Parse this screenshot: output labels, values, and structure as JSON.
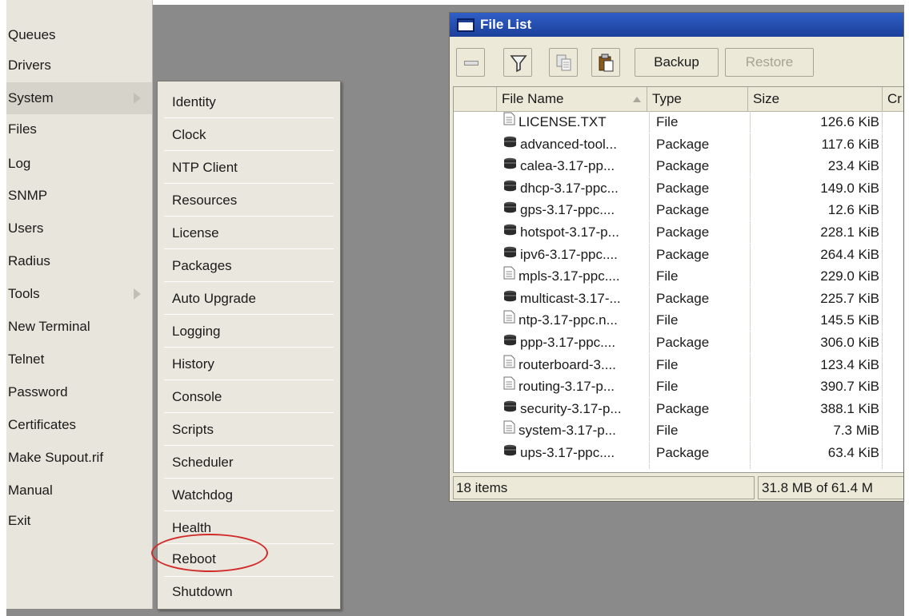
{
  "colors": {
    "desktop": "#8a8a8a",
    "menu_bg": "#e8e5dc",
    "title_bar": "#2f5fc7",
    "annotation": "#d12a2a"
  },
  "main_menu": {
    "items": [
      {
        "label": "Queues"
      },
      {
        "label": "Drivers"
      },
      {
        "label": "System",
        "has_submenu": true,
        "selected": true
      },
      {
        "label": "Files"
      },
      {
        "label": "Log"
      },
      {
        "label": "SNMP"
      },
      {
        "label": "Users"
      },
      {
        "label": "Radius"
      },
      {
        "label": "Tools",
        "has_submenu": true
      },
      {
        "label": "New Terminal"
      },
      {
        "label": "Telnet"
      },
      {
        "label": "Password"
      },
      {
        "label": "Certificates"
      },
      {
        "label": "Make Supout.rif"
      },
      {
        "label": "Manual"
      },
      {
        "label": "Exit"
      }
    ]
  },
  "system_submenu": {
    "items": [
      {
        "label": "Identity"
      },
      {
        "label": "Clock"
      },
      {
        "label": "NTP Client"
      },
      {
        "label": "Resources"
      },
      {
        "label": "License"
      },
      {
        "label": "Packages"
      },
      {
        "label": "Auto Upgrade"
      },
      {
        "label": "Logging"
      },
      {
        "label": "History"
      },
      {
        "label": "Console"
      },
      {
        "label": "Scripts"
      },
      {
        "label": "Scheduler"
      },
      {
        "label": "Watchdog"
      },
      {
        "label": "Health"
      },
      {
        "label": "Reboot",
        "highlighted_by_annotation": true
      },
      {
        "label": "Shutdown"
      }
    ]
  },
  "file_window": {
    "title": "File List",
    "toolbar": {
      "remove_icon": "minus-icon",
      "filter_icon": "funnel-icon",
      "copy_icon": "copy-icon",
      "paste_icon": "paste-icon",
      "backup_label": "Backup",
      "restore_label": "Restore"
    },
    "columns": [
      "File Name",
      "Type",
      "Size",
      "Cr"
    ],
    "sorted_column": "File Name",
    "rows": [
      {
        "name": "LICENSE.TXT",
        "type": "File",
        "size": "126.6 KiB",
        "icon": "file-icon"
      },
      {
        "name": "advanced-tool...",
        "type": "Package",
        "size": "117.6 KiB",
        "icon": "package-icon"
      },
      {
        "name": "calea-3.17-pp...",
        "type": "Package",
        "size": "23.4 KiB",
        "icon": "package-icon"
      },
      {
        "name": "dhcp-3.17-ppc...",
        "type": "Package",
        "size": "149.0 KiB",
        "icon": "package-icon"
      },
      {
        "name": "gps-3.17-ppc....",
        "type": "Package",
        "size": "12.6 KiB",
        "icon": "package-icon"
      },
      {
        "name": "hotspot-3.17-p...",
        "type": "Package",
        "size": "228.1 KiB",
        "icon": "package-icon"
      },
      {
        "name": "ipv6-3.17-ppc....",
        "type": "Package",
        "size": "264.4 KiB",
        "icon": "package-icon"
      },
      {
        "name": "mpls-3.17-ppc....",
        "type": "File",
        "size": "229.0 KiB",
        "icon": "file-icon"
      },
      {
        "name": "multicast-3.17-...",
        "type": "Package",
        "size": "225.7 KiB",
        "icon": "package-icon"
      },
      {
        "name": "ntp-3.17-ppc.n...",
        "type": "File",
        "size": "145.5 KiB",
        "icon": "file-icon"
      },
      {
        "name": "ppp-3.17-ppc....",
        "type": "Package",
        "size": "306.0 KiB",
        "icon": "package-icon"
      },
      {
        "name": "routerboard-3....",
        "type": "File",
        "size": "123.4 KiB",
        "icon": "file-icon"
      },
      {
        "name": "routing-3.17-p...",
        "type": "File",
        "size": "390.7 KiB",
        "icon": "file-icon"
      },
      {
        "name": "security-3.17-p...",
        "type": "Package",
        "size": "388.1 KiB",
        "icon": "package-icon"
      },
      {
        "name": "system-3.17-p...",
        "type": "File",
        "size": "7.3 MiB",
        "icon": "file-icon"
      },
      {
        "name": "ups-3.17-ppc....",
        "type": "Package",
        "size": "63.4 KiB",
        "icon": "package-icon"
      }
    ],
    "status": {
      "count": "18 items",
      "free_space": "31.8 MB of 61.4 M"
    }
  }
}
